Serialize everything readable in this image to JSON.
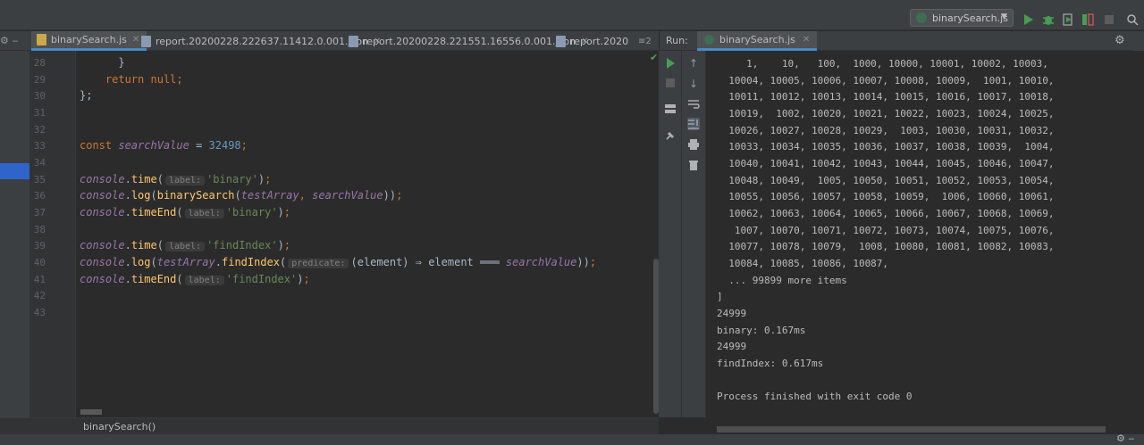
{
  "toolbar": {
    "run_config": "binarySearch.js"
  },
  "editor_tabs": [
    {
      "label": "binarySearch.js",
      "active": true
    },
    {
      "label": "report.20200228.222637.11412.0.001.json",
      "active": false
    },
    {
      "label": "report.20200228.221551.16556.0.001.json",
      "active": false
    },
    {
      "label": "report.2020",
      "active": false
    }
  ],
  "tabs_overflow": "≡2",
  "editor": {
    "line_numbers": [
      "28",
      "29",
      "30",
      "31",
      "32",
      "33",
      "34",
      "35",
      "36",
      "37",
      "38",
      "39",
      "40",
      "41",
      "42",
      "43"
    ],
    "breadcrumb": "binarySearch()",
    "hints": {
      "label": "label:",
      "predicate": "predicate:"
    },
    "tokens": {
      "brace": "}",
      "return": "return",
      "null": "null",
      "close_fn": "};",
      "const": "const",
      "searchValue": "searchValue",
      "number": "32498",
      "console": "console",
      "time": "time",
      "log": "log",
      "timeEnd": "timeEnd",
      "binarySearch": "binarySearch",
      "testArray": "testArray",
      "findIndex": "findIndex",
      "str_binary": "'binary'",
      "str_findIndex": "'findIndex'",
      "element": "element"
    }
  },
  "run_panel": {
    "label": "Run:",
    "tab": "binarySearch.js"
  },
  "console_lines": [
    "     1,    10,   100,  1000, 10000, 10001, 10002, 10003,",
    "  10004, 10005, 10006, 10007, 10008, 10009,  1001, 10010,",
    "  10011, 10012, 10013, 10014, 10015, 10016, 10017, 10018,",
    "  10019,  1002, 10020, 10021, 10022, 10023, 10024, 10025,",
    "  10026, 10027, 10028, 10029,  1003, 10030, 10031, 10032,",
    "  10033, 10034, 10035, 10036, 10037, 10038, 10039,  1004,",
    "  10040, 10041, 10042, 10043, 10044, 10045, 10046, 10047,",
    "  10048, 10049,  1005, 10050, 10051, 10052, 10053, 10054,",
    "  10055, 10056, 10057, 10058, 10059,  1006, 10060, 10061,",
    "  10062, 10063, 10064, 10065, 10066, 10067, 10068, 10069,",
    "   1007, 10070, 10071, 10072, 10073, 10074, 10075, 10076,",
    "  10077, 10078, 10079,  1008, 10080, 10081, 10082, 10083,",
    "  10084, 10085, 10086, 10087,",
    "  ... 99899 more items",
    "]",
    "24999",
    "binary: 0.167ms",
    "24999",
    "findIndex: 0.617ms",
    "",
    "Process finished with exit code 0"
  ],
  "colors": {
    "accent": "#4a88c7",
    "run_green": "#499c54",
    "keyword": "#cc7832",
    "string": "#6a8759",
    "number": "#6897bb",
    "instance": "#9876aa",
    "function": "#ffc66d"
  }
}
